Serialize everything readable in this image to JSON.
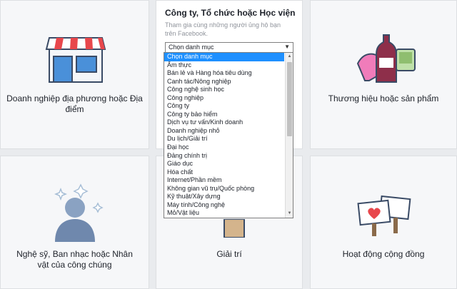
{
  "cards": {
    "local_business": {
      "label": "Doanh nghiệp địa phương hoặc Địa điểm",
      "icon": "storefront-icon"
    },
    "company": {
      "title": "Công ty, Tổ chức hoặc Học viện",
      "description": "Tham gia cùng những người ủng hộ bạn trên Facebook.",
      "select_value": "Chọn danh mục"
    },
    "brand": {
      "label": "Thương hiệu hoặc sản phẩm",
      "icon": "brand-products-icon"
    },
    "artist": {
      "label": "Nghệ sỹ, Ban nhạc hoặc Nhân vật của công chúng",
      "icon": "public-figure-icon"
    },
    "entertainment": {
      "label": "Giải trí",
      "icon": "entertainment-icon"
    },
    "community": {
      "label": "Hoạt động cộng đồng",
      "icon": "community-signs-icon"
    }
  },
  "dropdown": {
    "options": [
      "Chọn danh mục",
      "Ẩm thực",
      "Bán lẻ và Hàng hóa tiêu dùng",
      "Canh tác/Nông nghiệp",
      "Công nghệ sinh học",
      "Công nghiệp",
      "Công ty",
      "Công ty bảo hiểm",
      "Dịch vụ tư vấn/Kinh doanh",
      "Doanh nghiệp nhỏ",
      "Du lịch/Giải trí",
      "Đại học",
      "Đảng chính trị",
      "Giáo dục",
      "Hóa chất",
      "Internet/Phần mềm",
      "Không gian vũ trụ/Quốc phòng",
      "Kỹ thuật/Xây dựng",
      "Máy tính/Công nghệ",
      "Mỏ/Vật liệu"
    ],
    "selected": "Chọn danh mục"
  },
  "colors": {
    "highlight": "#1e90ff",
    "background": "#e9ebee",
    "card": "#f6f7f9"
  }
}
